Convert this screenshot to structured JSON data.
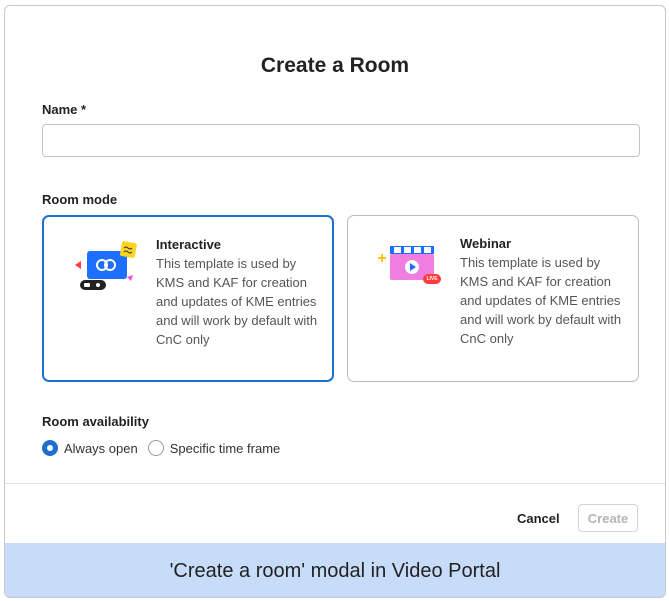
{
  "modal": {
    "title": "Create a Room",
    "name_label": "Name *",
    "name_value": "",
    "name_placeholder": "",
    "room_mode_label": "Room mode",
    "modes": [
      {
        "title": "Interactive",
        "description": "This template is used by KMS and KAF for creation and updates of KME entries and will work by default with CnC only",
        "selected": true,
        "icon": "interactive-room-illustration"
      },
      {
        "title": "Webinar",
        "description": "This template is used by KMS and KAF for creation and updates of KME entries and will work by default with CnC only",
        "selected": false,
        "icon": "webinar-illustration",
        "badge": "LIVE"
      }
    ],
    "availability_label": "Room availability",
    "availability_options": [
      {
        "label": "Always open",
        "selected": true
      },
      {
        "label": "Specific time frame",
        "selected": false
      }
    ],
    "cancel_label": "Cancel",
    "create_label": "Create"
  },
  "caption": "'Create a room' modal in Video Portal",
  "colors": {
    "accent": "#1f6fd1",
    "caption_bg": "#c6dcf8"
  }
}
